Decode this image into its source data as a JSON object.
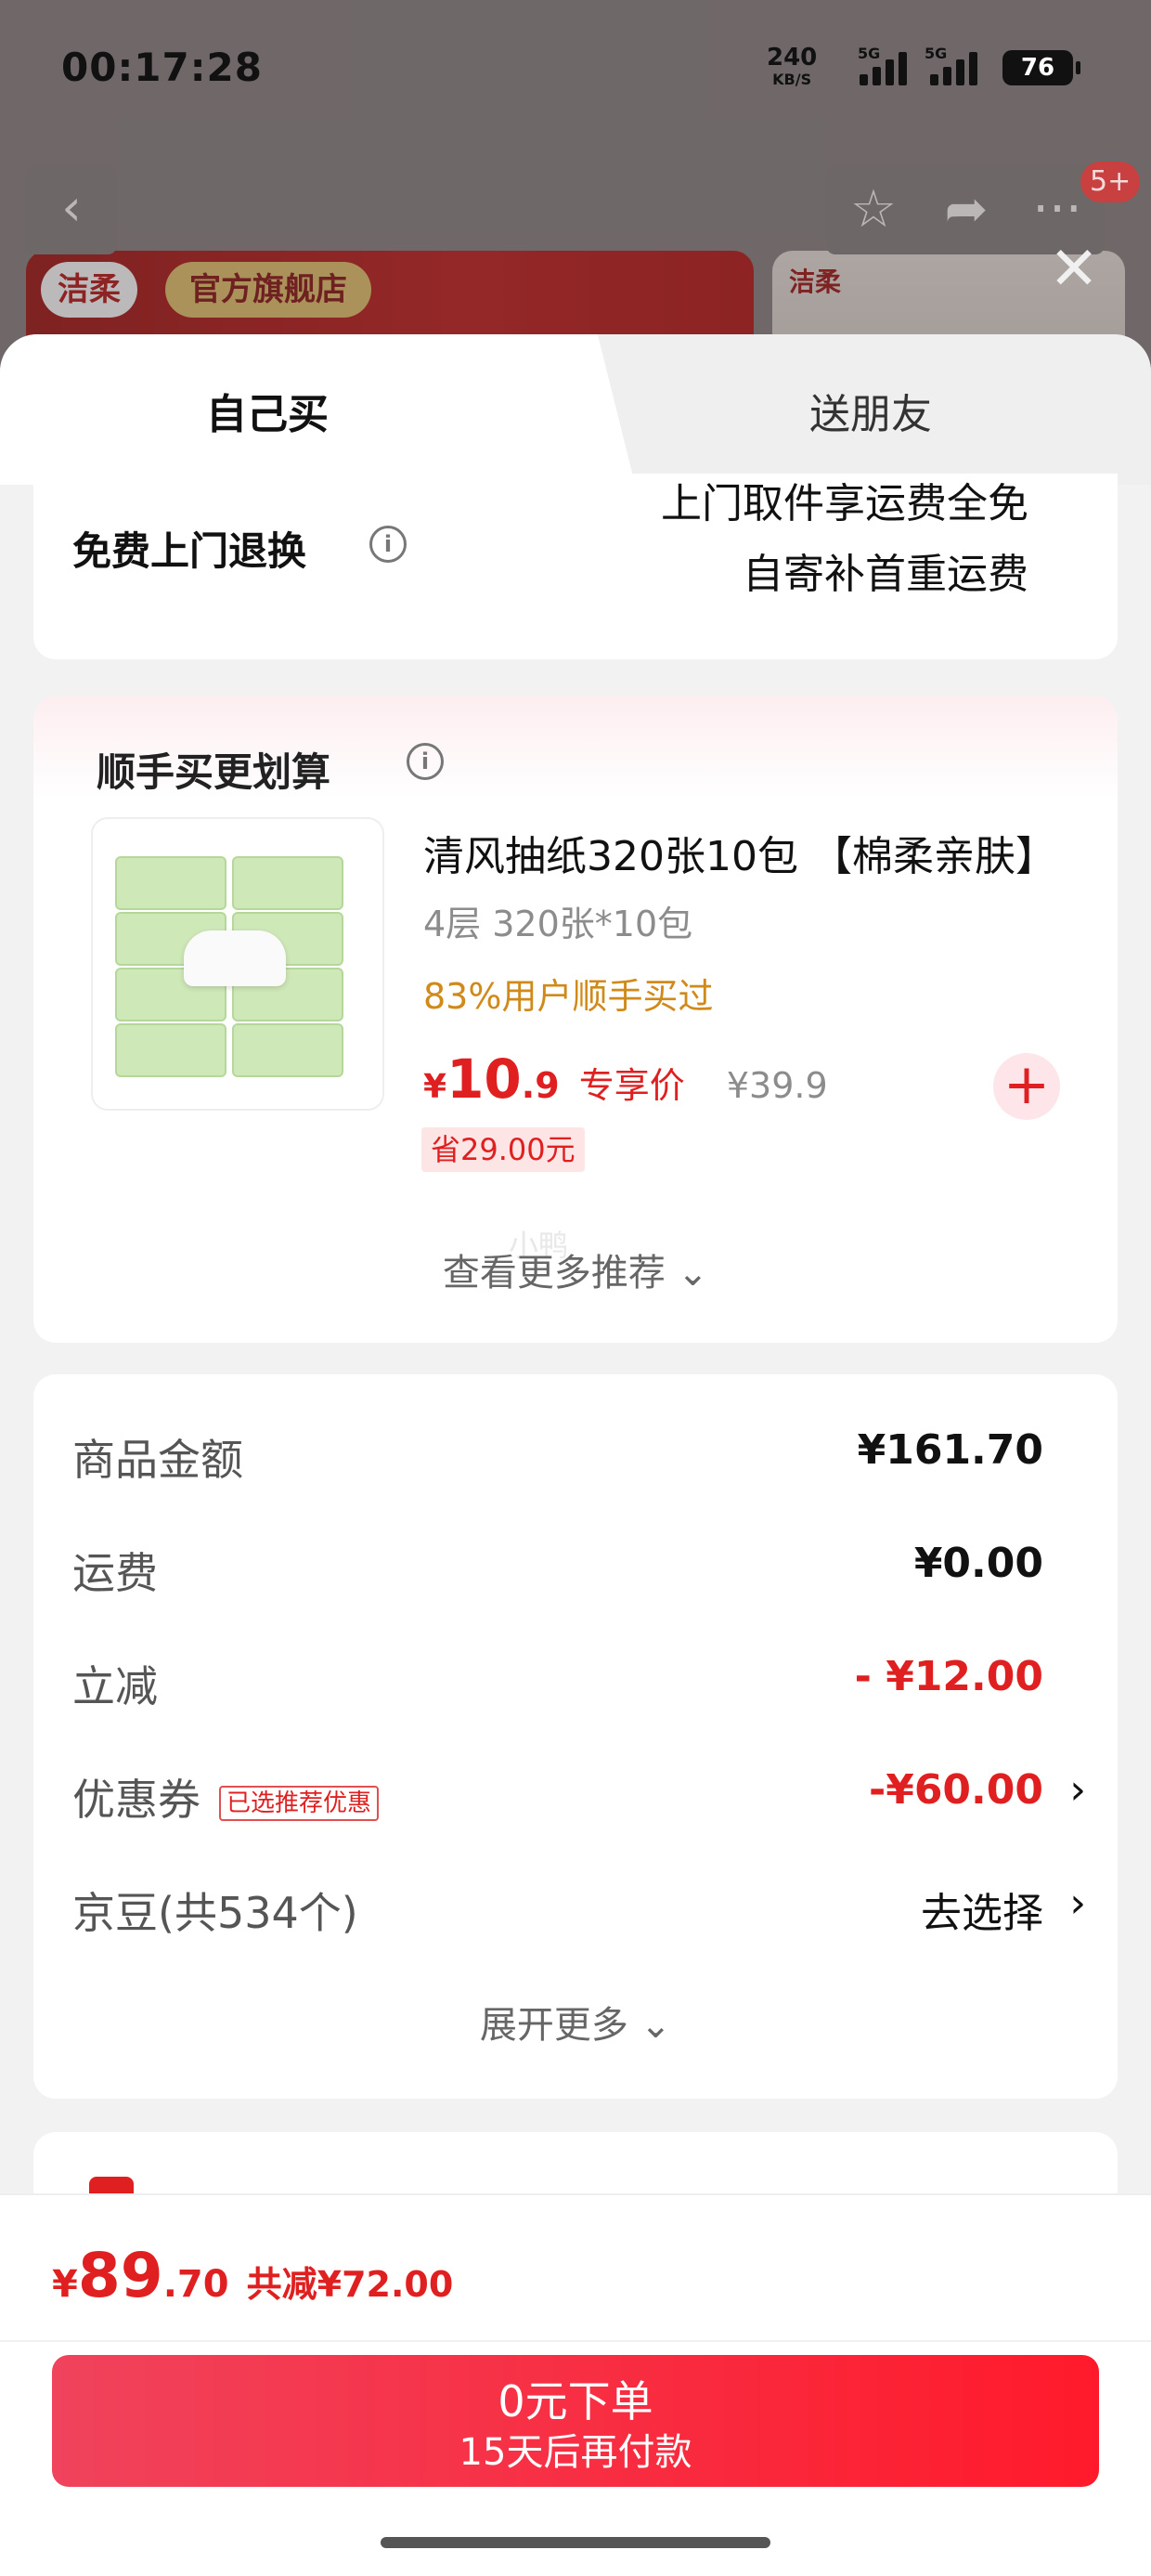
{
  "status_bar": {
    "time": "00:17:28",
    "net_speed": "240",
    "net_unit": "KB/S",
    "signal_1": "5G",
    "signal_2": "5G",
    "battery": "76"
  },
  "background": {
    "brand_logo": "洁柔",
    "store_name": "官方旗舰店",
    "brand_logo_2": "洁柔",
    "nav_badge": "5+"
  },
  "tabs": [
    {
      "label": "自己买",
      "active": true
    },
    {
      "label": "送朋友",
      "active": false
    }
  ],
  "return_service": {
    "title": "免费上门退换",
    "line1": "上门取件享运费全免",
    "line2": "自寄补首重运费"
  },
  "recommend": {
    "title": "顺手买更划算",
    "product": {
      "name": "清风抽纸320张10包 【棉柔亲肤】",
      "spec": "4层 320张*10包",
      "bought": "83%用户顺手买过",
      "price_symbol": "¥",
      "price_int": "10",
      "price_dec": ".9",
      "price_tag": "专享价",
      "original_price": "¥39.9",
      "save": "省29.00元"
    },
    "more": "查看更多推荐",
    "watermark": "小鸭"
  },
  "summary": {
    "rows": [
      {
        "label": "商品金额",
        "value": "¥161.70"
      },
      {
        "label": "运费",
        "value": "¥0.00"
      },
      {
        "label": "立减",
        "value": "- ¥12.00"
      },
      {
        "label": "优惠券",
        "tag": "已选推荐优惠",
        "value": "-¥60.00"
      },
      {
        "label": "京豆(共534个)",
        "value": "去选择"
      }
    ],
    "expand": "展开更多"
  },
  "footer": {
    "price_symbol": "¥",
    "price_int": "89",
    "price_dec": ".70",
    "reduced": "共减¥72.00",
    "pay_main": "0元下单",
    "pay_sub": "15天后再付款"
  },
  "icons": {
    "back": "chevron-left-icon",
    "favorite": "star-icon",
    "share": "share-icon",
    "more": "more-icon",
    "close": "close-icon",
    "info": "info-icon",
    "add": "plus-icon",
    "chevron_down": "chevron-down-icon",
    "chevron_right": "chevron-right-icon"
  },
  "colors": {
    "accent_red": "#e02020",
    "orange": "#d08a1a",
    "button_gradient_start": "#f0435c",
    "button_gradient_end": "#ff1a2b"
  }
}
